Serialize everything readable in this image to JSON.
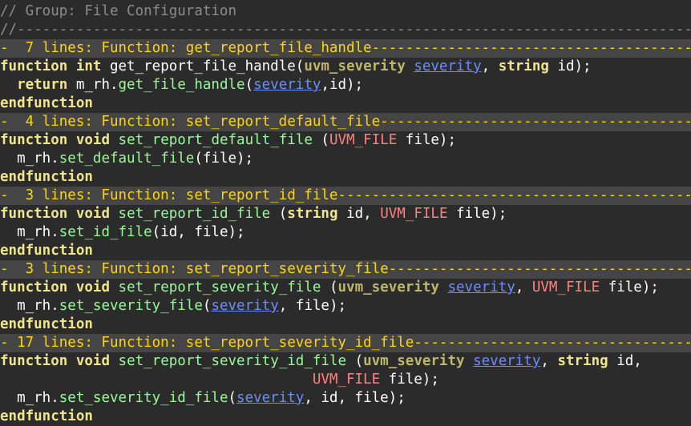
{
  "editor": {
    "lines": [
      {
        "kind": "code",
        "tokens": [
          {
            "t": "// Group: File Configuration",
            "c": "comment"
          }
        ]
      },
      {
        "kind": "code",
        "tokens": [
          {
            "t": "//-------------------------------------------------------------------------------------",
            "c": "comment"
          }
        ]
      },
      {
        "kind": "fold",
        "tokens": [
          {
            "t": "-  7 lines: Function: get_report_file_handle--------------------------------------------",
            "c": "fold"
          }
        ]
      },
      {
        "kind": "code",
        "tokens": [
          {
            "t": "function",
            "c": "kw"
          },
          {
            "t": " ",
            "c": "plain"
          },
          {
            "t": "int",
            "c": "kw"
          },
          {
            "t": " get_report_file_handle(",
            "c": "plain"
          },
          {
            "t": "uvm_severity",
            "c": "type"
          },
          {
            "t": " ",
            "c": "plain"
          },
          {
            "t": "severity",
            "c": "ul"
          },
          {
            "t": ", ",
            "c": "plain"
          },
          {
            "t": "string",
            "c": "kw"
          },
          {
            "t": " id);",
            "c": "plain"
          }
        ]
      },
      {
        "kind": "code",
        "tokens": [
          {
            "t": "  ",
            "c": "plain"
          },
          {
            "t": "return",
            "c": "kw"
          },
          {
            "t": " m_rh.",
            "c": "plain"
          },
          {
            "t": "get_file_handle",
            "c": "fn"
          },
          {
            "t": "(",
            "c": "plain"
          },
          {
            "t": "severity",
            "c": "ul"
          },
          {
            "t": ",id);",
            "c": "plain"
          }
        ]
      },
      {
        "kind": "code",
        "tokens": [
          {
            "t": "endfunction",
            "c": "kw"
          }
        ]
      },
      {
        "kind": "fold",
        "tokens": [
          {
            "t": "-  4 lines: Function: set_report_default_file------------------------------------------",
            "c": "fold"
          }
        ]
      },
      {
        "kind": "code",
        "tokens": [
          {
            "t": "function",
            "c": "kw"
          },
          {
            "t": " ",
            "c": "plain"
          },
          {
            "t": "void",
            "c": "kw"
          },
          {
            "t": " ",
            "c": "plain"
          },
          {
            "t": "set_report_default_file",
            "c": "fn"
          },
          {
            "t": " (",
            "c": "plain"
          },
          {
            "t": "UVM_FILE",
            "c": "const"
          },
          {
            "t": " file);",
            "c": "plain"
          }
        ]
      },
      {
        "kind": "code",
        "tokens": [
          {
            "t": "  m_rh.",
            "c": "plain"
          },
          {
            "t": "set_default_file",
            "c": "fn"
          },
          {
            "t": "(file);",
            "c": "plain"
          }
        ]
      },
      {
        "kind": "code",
        "tokens": [
          {
            "t": "endfunction",
            "c": "kw"
          }
        ]
      },
      {
        "kind": "fold",
        "tokens": [
          {
            "t": "-  3 lines: Function: set_report_id_file-----------------------------------------------",
            "c": "fold"
          }
        ]
      },
      {
        "kind": "code",
        "tokens": [
          {
            "t": "function",
            "c": "kw"
          },
          {
            "t": " ",
            "c": "plain"
          },
          {
            "t": "void",
            "c": "kw"
          },
          {
            "t": " ",
            "c": "plain"
          },
          {
            "t": "set_report_id_file",
            "c": "fn"
          },
          {
            "t": " (",
            "c": "plain"
          },
          {
            "t": "string",
            "c": "kw"
          },
          {
            "t": " id, ",
            "c": "plain"
          },
          {
            "t": "UVM_FILE",
            "c": "const"
          },
          {
            "t": " file);",
            "c": "plain"
          }
        ]
      },
      {
        "kind": "code",
        "tokens": [
          {
            "t": "  m_rh.",
            "c": "plain"
          },
          {
            "t": "set_id_file",
            "c": "fn"
          },
          {
            "t": "(id, file);",
            "c": "plain"
          }
        ]
      },
      {
        "kind": "code",
        "tokens": [
          {
            "t": "endfunction",
            "c": "kw"
          }
        ]
      },
      {
        "kind": "fold",
        "tokens": [
          {
            "t": "-  3 lines: Function: set_report_severity_file-----------------------------------------",
            "c": "fold"
          }
        ]
      },
      {
        "kind": "code",
        "tokens": [
          {
            "t": "function",
            "c": "kw"
          },
          {
            "t": " ",
            "c": "plain"
          },
          {
            "t": "void",
            "c": "kw"
          },
          {
            "t": " ",
            "c": "plain"
          },
          {
            "t": "set_report_severity_file",
            "c": "fn"
          },
          {
            "t": " (",
            "c": "plain"
          },
          {
            "t": "uvm_severity",
            "c": "type"
          },
          {
            "t": " ",
            "c": "plain"
          },
          {
            "t": "severity",
            "c": "ul"
          },
          {
            "t": ", ",
            "c": "plain"
          },
          {
            "t": "UVM_FILE",
            "c": "const"
          },
          {
            "t": " file);",
            "c": "plain"
          }
        ]
      },
      {
        "kind": "code",
        "tokens": [
          {
            "t": "  m_rh.",
            "c": "plain"
          },
          {
            "t": "set_severity_file",
            "c": "fn"
          },
          {
            "t": "(",
            "c": "plain"
          },
          {
            "t": "severity",
            "c": "ul"
          },
          {
            "t": ", file);",
            "c": "plain"
          }
        ]
      },
      {
        "kind": "code",
        "tokens": [
          {
            "t": "endfunction",
            "c": "kw"
          }
        ]
      },
      {
        "kind": "fold",
        "tokens": [
          {
            "t": "- 17 lines: Function: set_report_severity_id_file--------------------------------------",
            "c": "fold"
          }
        ]
      },
      {
        "kind": "code",
        "tokens": [
          {
            "t": "function",
            "c": "kw"
          },
          {
            "t": " ",
            "c": "plain"
          },
          {
            "t": "void",
            "c": "kw"
          },
          {
            "t": " ",
            "c": "plain"
          },
          {
            "t": "set_report_severity_id_file",
            "c": "fn"
          },
          {
            "t": " (",
            "c": "plain"
          },
          {
            "t": "uvm_severity",
            "c": "type"
          },
          {
            "t": " ",
            "c": "plain"
          },
          {
            "t": "severity",
            "c": "ul"
          },
          {
            "t": ", ",
            "c": "plain"
          },
          {
            "t": "string",
            "c": "kw"
          },
          {
            "t": " id,",
            "c": "plain"
          }
        ]
      },
      {
        "kind": "code",
        "tokens": [
          {
            "t": "                                     ",
            "c": "plain"
          },
          {
            "t": "UVM_FILE",
            "c": "const"
          },
          {
            "t": " file);",
            "c": "plain"
          }
        ]
      },
      {
        "kind": "code",
        "tokens": [
          {
            "t": "  m_rh.",
            "c": "plain"
          },
          {
            "t": "set_severity_id_file",
            "c": "fn"
          },
          {
            "t": "(",
            "c": "plain"
          },
          {
            "t": "severity",
            "c": "ul"
          },
          {
            "t": ", id, file);",
            "c": "plain"
          }
        ]
      },
      {
        "kind": "code",
        "tokens": [
          {
            "t": "endfunction",
            "c": "kw"
          }
        ]
      }
    ]
  },
  "colors": {
    "background": "#2b2b2b",
    "fold_background": "#454545",
    "comment": "#8c8c8c",
    "fold_text": "#ffd700",
    "keyword": "#f0e68c",
    "type": "#bdb76b",
    "function": "#98fb98",
    "constant": "#ff8080",
    "underlined": "#6b8eff"
  }
}
